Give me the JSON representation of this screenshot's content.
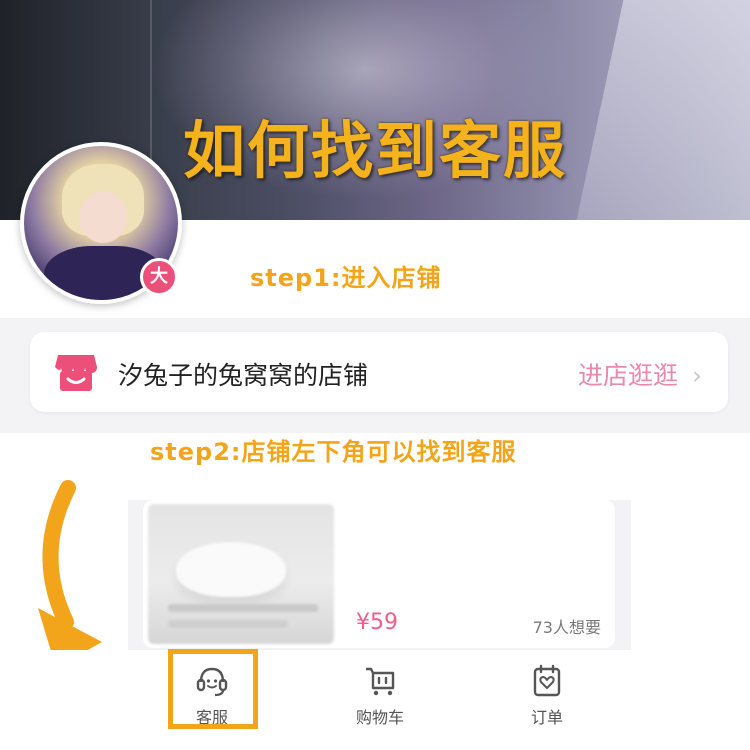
{
  "banner": {
    "title": "如何找到客服"
  },
  "avatar": {
    "badge": "大"
  },
  "steps": {
    "step1": "step1:进入店铺",
    "step2": "step2:店铺左下角可以找到客服"
  },
  "shop": {
    "name": "汐兔子的兔窝窝的店铺",
    "enter_label": "进店逛逛",
    "chevron": "›"
  },
  "product": {
    "price": "¥59",
    "wants": "73人想要"
  },
  "bottom_nav": {
    "items": [
      {
        "label": "客服",
        "icon": "customer-service-icon"
      },
      {
        "label": "购物车",
        "icon": "cart-icon"
      },
      {
        "label": "订单",
        "icon": "orders-icon"
      }
    ]
  },
  "colors": {
    "accent_orange": "#f2a51b",
    "accent_pink": "#ec4f7a",
    "enter_shop_pink": "#e88ab0",
    "price_pink": "#ec5f8c"
  }
}
